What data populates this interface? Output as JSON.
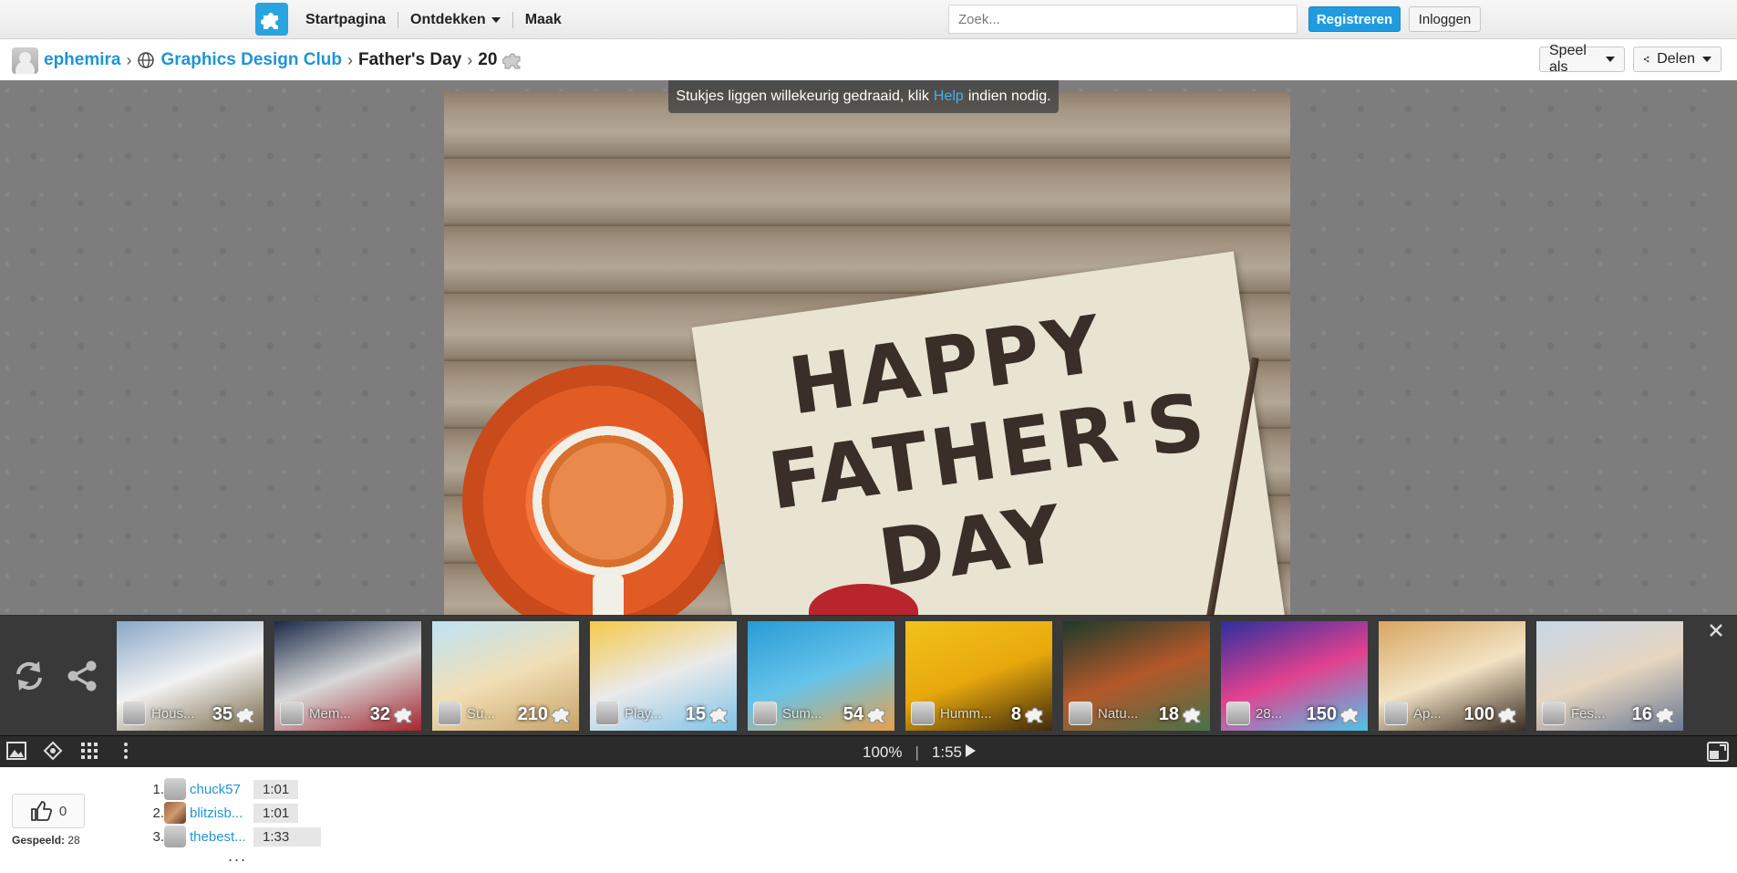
{
  "nav": {
    "home": "Startpagina",
    "discover": "Ontdekken",
    "create": "Maak",
    "search_placeholder": "Zoek...",
    "register": "Registreren",
    "login": "Inloggen"
  },
  "breadcrumb": {
    "user": "ephemira",
    "club": "Graphics Design Club",
    "puzzle": "Father's Day",
    "pieces": "20"
  },
  "actions": {
    "play_as": "Speel als",
    "share": "Delen"
  },
  "notice": {
    "before": "Stukjes liggen willekeurig gedraaid, klik",
    "link": "Help",
    "after": "indien nodig."
  },
  "puzzle_image": {
    "text_lines": [
      "HAPPY",
      "FATHER'S",
      "DAY"
    ]
  },
  "related": [
    {
      "title": "Hous...",
      "count": "35",
      "colors": [
        "#8aa7c9",
        "#f2f2f2",
        "#7a6a4a"
      ]
    },
    {
      "title": "Mem...",
      "count": "32",
      "colors": [
        "#1c2b4a",
        "#d8d8d8",
        "#a5262f"
      ]
    },
    {
      "title": "Su...",
      "count": "210",
      "colors": [
        "#bde3f5",
        "#f1dfb5",
        "#c8a36a"
      ]
    },
    {
      "title": "Play...",
      "count": "15",
      "colors": [
        "#f5c94a",
        "#eaeaea",
        "#7fc3e8"
      ]
    },
    {
      "title": "Sum...",
      "count": "54",
      "colors": [
        "#2a9bd6",
        "#65c3ea",
        "#e6a14a"
      ]
    },
    {
      "title": "Humm...",
      "count": "8",
      "colors": [
        "#f2c21a",
        "#e8a80d",
        "#3d2b0c"
      ]
    },
    {
      "title": "Natu...",
      "count": "18",
      "colors": [
        "#1d3a2a",
        "#b4582a",
        "#48724a"
      ]
    },
    {
      "title": "28...",
      "count": "150",
      "colors": [
        "#2b2f9e",
        "#e2418f",
        "#4fc4e8"
      ]
    },
    {
      "title": "Ap...",
      "count": "100",
      "colors": [
        "#d8a561",
        "#f2e3c4",
        "#3b2d22"
      ]
    },
    {
      "title": "Fes...",
      "count": "16",
      "colors": [
        "#c8d6e8",
        "#e6d5c0",
        "#6b7a93"
      ]
    }
  ],
  "status": {
    "zoom": "100%",
    "time": "1:55"
  },
  "likes": "0",
  "played": {
    "label": "Gespeeld:",
    "count": "28"
  },
  "scores": [
    {
      "rank": "1.",
      "name": "chuck57",
      "time": "1:01"
    },
    {
      "rank": "2.",
      "name": "blitzisb...",
      "time": "1:01"
    },
    {
      "rank": "3.",
      "name": "thebest...",
      "time": "1:33"
    }
  ],
  "more": "..."
}
